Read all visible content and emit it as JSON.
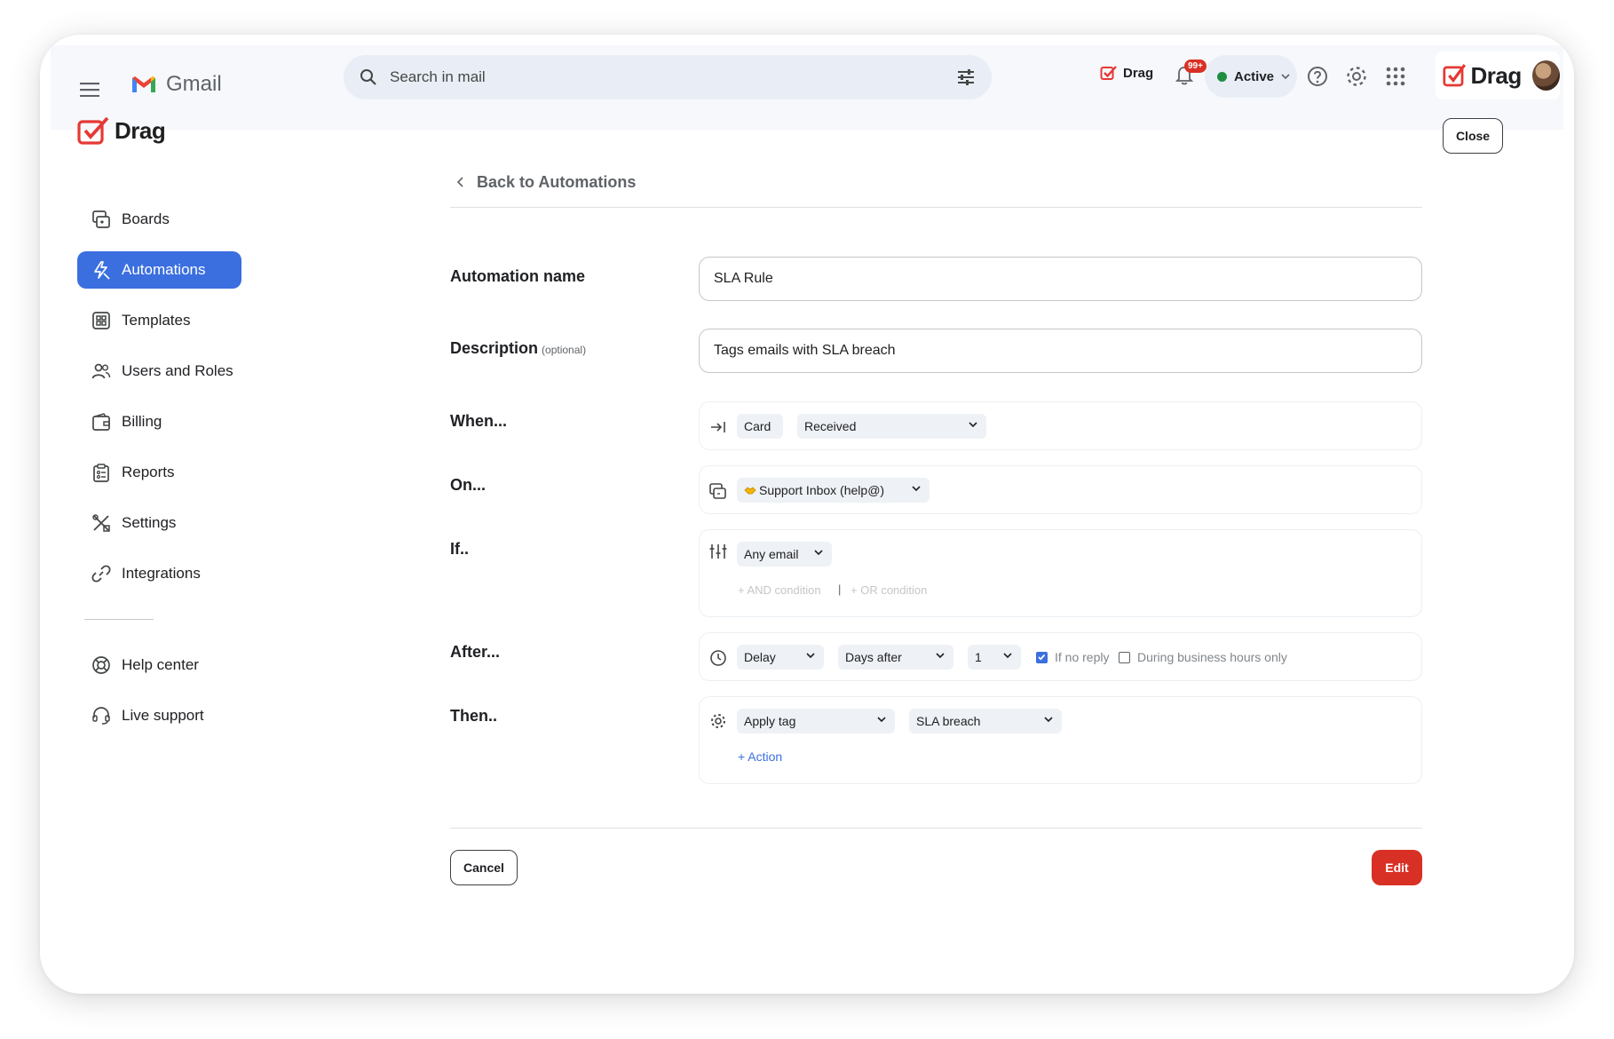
{
  "gmail": {
    "logo_text": "Gmail",
    "search_placeholder": "Search in mail",
    "drag_label": "Drag",
    "notification_count": "99+",
    "status_label": "Active",
    "brand_text": "Drag"
  },
  "app": {
    "logo_text": "Drag",
    "close_label": "Close"
  },
  "sidebar": {
    "items": [
      {
        "label": "Boards",
        "icon": "boards-icon",
        "active": false
      },
      {
        "label": "Automations",
        "icon": "lightning-icon",
        "active": true
      },
      {
        "label": "Templates",
        "icon": "templates-icon",
        "active": false
      },
      {
        "label": "Users and Roles",
        "icon": "users-icon",
        "active": false
      },
      {
        "label": "Billing",
        "icon": "wallet-icon",
        "active": false
      },
      {
        "label": "Reports",
        "icon": "clipboard-icon",
        "active": false
      },
      {
        "label": "Settings",
        "icon": "tools-icon",
        "active": false
      },
      {
        "label": "Integrations",
        "icon": "link-icon",
        "active": false
      }
    ],
    "bottom_items": [
      {
        "label": "Help center",
        "icon": "lifebuoy-icon"
      },
      {
        "label": "Live support",
        "icon": "headset-icon"
      }
    ]
  },
  "form": {
    "back_label": "Back to Automations",
    "name_label": "Automation name",
    "name_value": "SLA Rule",
    "description_label": "Description",
    "description_optional": "(optional)",
    "description_value": "Tags emails with SLA breach",
    "when_label": "When...",
    "when_object": "Card",
    "when_event": "Received",
    "on_label": "On...",
    "on_board": "Support Inbox (help@)",
    "if_label": "If..",
    "if_condition": "Any email",
    "and_condition": "+ AND condition",
    "or_separator": "|",
    "or_condition": "+ OR condition",
    "after_label": "After...",
    "after_type": "Delay",
    "after_unit": "Days after",
    "after_amount": "1",
    "if_no_reply_label": "If no reply",
    "if_no_reply_checked": true,
    "business_hours_label": "During business hours only",
    "business_hours_checked": false,
    "then_label": "Then..",
    "then_action": "Apply tag",
    "then_tag": "SLA breach",
    "add_action_label": "+ Action",
    "cancel_label": "Cancel",
    "edit_label": "Edit"
  },
  "colors": {
    "accent": "#3b6fe0",
    "danger": "#d93025",
    "brand_red": "#e53935"
  }
}
